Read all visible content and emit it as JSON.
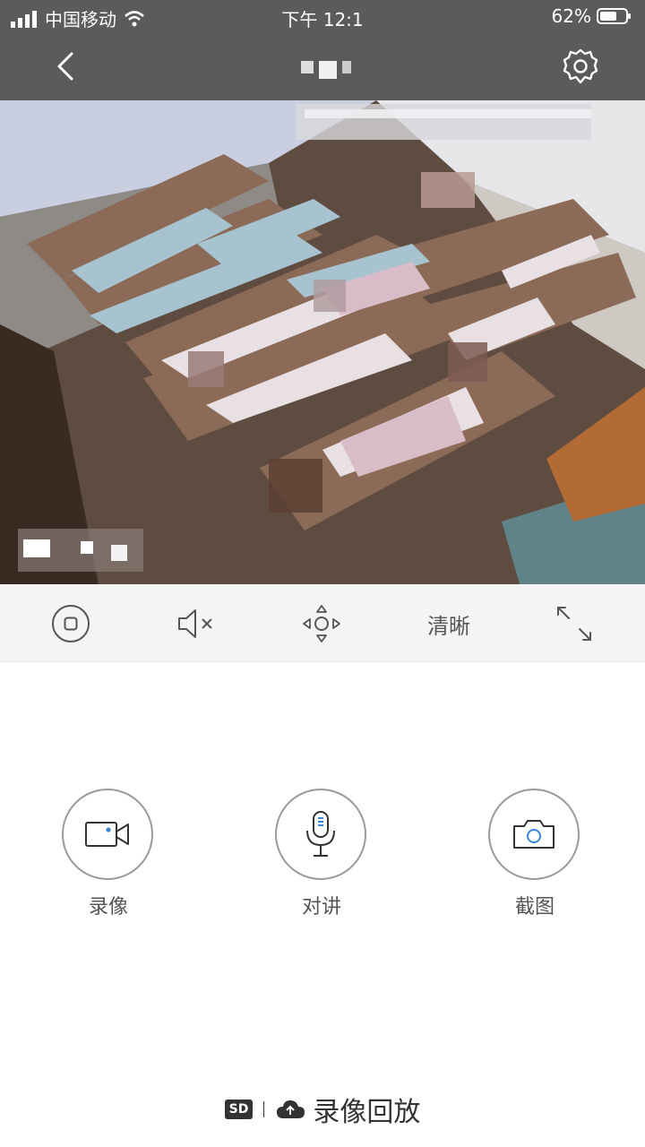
{
  "status": {
    "carrier": "中国移动",
    "time": "下午 12:1",
    "battery": "62%"
  },
  "controls": {
    "quality_label": "清晰"
  },
  "actions": [
    {
      "label": "录像",
      "icon": "video-camera-icon"
    },
    {
      "label": "对讲",
      "icon": "microphone-icon"
    },
    {
      "label": "截图",
      "icon": "camera-icon"
    }
  ],
  "playback": {
    "badge": "SD",
    "label": "录像回放",
    "icon": "cloud-icon"
  },
  "colors": {
    "topbar": "#5b5b5b",
    "accent": "#3a86d6",
    "controls_bg": "#f4f4f4"
  }
}
